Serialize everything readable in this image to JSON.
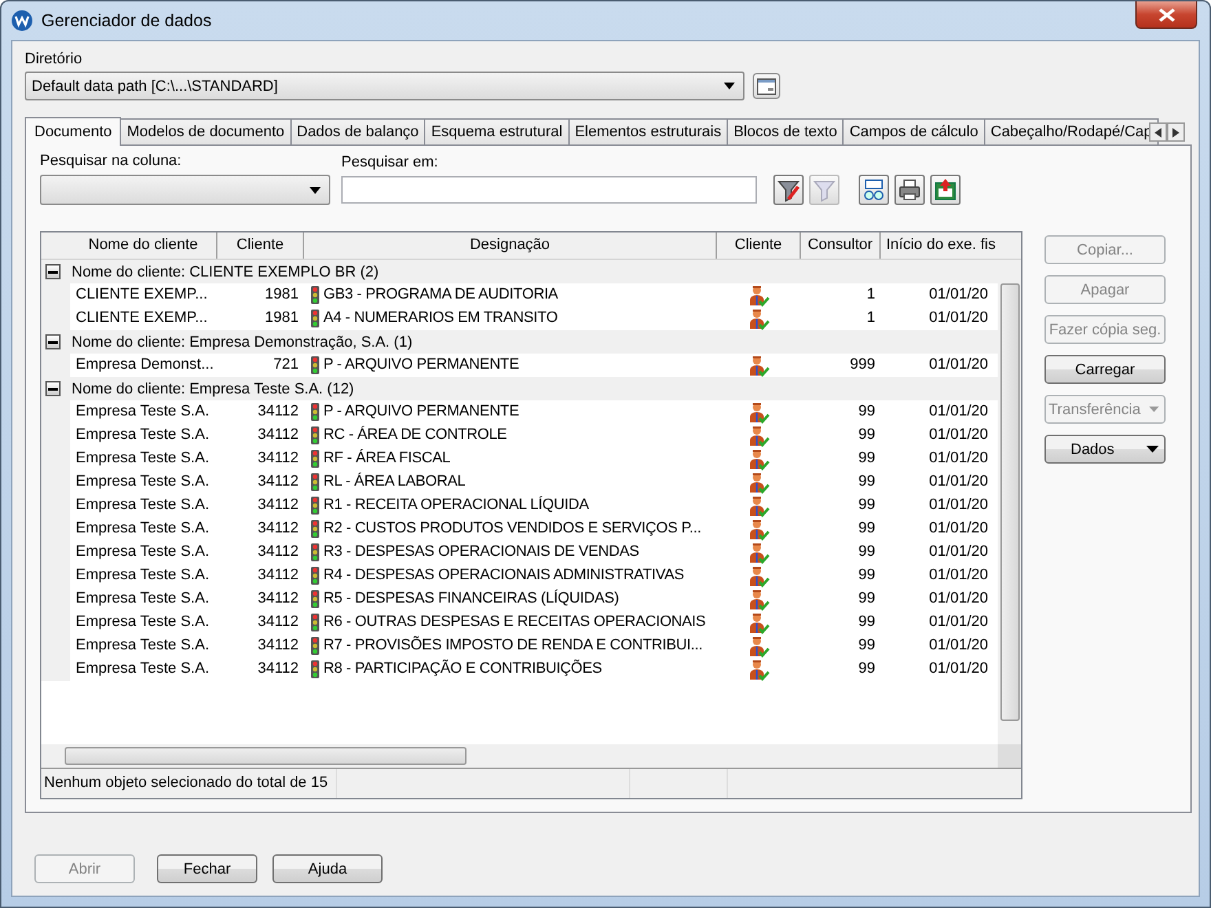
{
  "window": {
    "title": "Gerenciador de dados"
  },
  "directory": {
    "label": "Diretório",
    "value": "Default data path [C:\\...\\STANDARD]"
  },
  "tabs": [
    {
      "label": "Documento",
      "selected": true
    },
    {
      "label": "Modelos de documento",
      "selected": false
    },
    {
      "label": "Dados de balanço",
      "selected": false
    },
    {
      "label": "Esquema estrutural",
      "selected": false
    },
    {
      "label": "Elementos estruturais",
      "selected": false
    },
    {
      "label": "Blocos de texto",
      "selected": false
    },
    {
      "label": "Campos de cálculo",
      "selected": false
    },
    {
      "label": "Cabeçalho/Rodapé/Cap",
      "selected": false
    }
  ],
  "search": {
    "column_label": "Pesquisar na coluna:",
    "in_label": "Pesquisar em:"
  },
  "table": {
    "columns": [
      "Nome do cliente",
      "Cliente",
      "Designação",
      "Cliente",
      "Consultor",
      "Início do exe. fis"
    ],
    "groups": [
      {
        "label": "Nome do cliente: CLIENTE EXEMPLO BR (2)",
        "expanded": true,
        "rows": [
          {
            "name": "CLIENTE EXEMP...",
            "client": "1981",
            "designation": "GB3 - PROGRAMA DE AUDITORIA",
            "consultant": "1",
            "start": "01/01/20"
          },
          {
            "name": "CLIENTE EXEMP...",
            "client": "1981",
            "designation": "A4 - NUMERARIOS EM TRANSITO",
            "consultant": "1",
            "start": "01/01/20"
          }
        ]
      },
      {
        "label": "Nome do cliente: Empresa Demonstração, S.A. (1)",
        "expanded": true,
        "rows": [
          {
            "name": "Empresa Demonst...",
            "client": "721",
            "designation": "P - ARQUIVO PERMANENTE",
            "consultant": "999",
            "start": "01/01/20"
          }
        ]
      },
      {
        "label": "Nome do cliente: Empresa Teste S.A. (12)",
        "expanded": true,
        "rows": [
          {
            "name": "Empresa Teste S.A.",
            "client": "34112",
            "designation": "P - ARQUIVO PERMANENTE",
            "consultant": "99",
            "start": "01/01/20"
          },
          {
            "name": "Empresa Teste S.A.",
            "client": "34112",
            "designation": "RC - ÁREA DE CONTROLE",
            "consultant": "99",
            "start": "01/01/20"
          },
          {
            "name": "Empresa Teste S.A.",
            "client": "34112",
            "designation": "RF - ÁREA FISCAL",
            "consultant": "99",
            "start": "01/01/20"
          },
          {
            "name": "Empresa Teste S.A.",
            "client": "34112",
            "designation": "RL - ÁREA LABORAL",
            "consultant": "99",
            "start": "01/01/20"
          },
          {
            "name": "Empresa Teste S.A.",
            "client": "34112",
            "designation": "R1 - RECEITA OPERACIONAL LÍQUIDA",
            "consultant": "99",
            "start": "01/01/20"
          },
          {
            "name": "Empresa Teste S.A.",
            "client": "34112",
            "designation": "R2 - CUSTOS PRODUTOS VENDIDOS E SERVIÇOS P...",
            "consultant": "99",
            "start": "01/01/20"
          },
          {
            "name": "Empresa Teste S.A.",
            "client": "34112",
            "designation": "R3 - DESPESAS OPERACIONAIS DE VENDAS",
            "consultant": "99",
            "start": "01/01/20"
          },
          {
            "name": "Empresa Teste S.A.",
            "client": "34112",
            "designation": "R4 - DESPESAS OPERACIONAIS ADMINISTRATIVAS",
            "consultant": "99",
            "start": "01/01/20"
          },
          {
            "name": "Empresa Teste S.A.",
            "client": "34112",
            "designation": "R5 - DESPESAS FINANCEIRAS (LÍQUIDAS)",
            "consultant": "99",
            "start": "01/01/20"
          },
          {
            "name": "Empresa Teste S.A.",
            "client": "34112",
            "designation": "R6 - OUTRAS DESPESAS E RECEITAS OPERACIONAIS",
            "consultant": "99",
            "start": "01/01/20"
          },
          {
            "name": "Empresa Teste S.A.",
            "client": "34112",
            "designation": "R7 - PROVISÕES IMPOSTO DE RENDA E CONTRIBUI...",
            "consultant": "99",
            "start": "01/01/20"
          },
          {
            "name": "Empresa Teste S.A.",
            "client": "34112",
            "designation": "R8 - PARTICIPAÇÃO E CONTRIBUIÇÕES",
            "consultant": "99",
            "start": "01/01/20"
          }
        ]
      }
    ]
  },
  "status_bar": "Nenhum objeto selecionado do total de 15",
  "side_buttons": [
    {
      "label": "Copiar...",
      "kind": "plain",
      "disabled": true
    },
    {
      "label": "Apagar",
      "kind": "plain",
      "disabled": true
    },
    {
      "label": "Fazer cópia seg.",
      "kind": "plain",
      "disabled": true
    },
    {
      "label": "Carregar",
      "kind": "plain",
      "disabled": false
    },
    {
      "label": "Transferência",
      "kind": "dropdown",
      "disabled": true
    },
    {
      "label": "Dados",
      "kind": "dropdown",
      "disabled": false
    }
  ],
  "bottom_buttons": [
    {
      "label": "Abrir",
      "disabled": true
    },
    {
      "label": "Fechar",
      "disabled": false
    },
    {
      "label": "Ajuda",
      "disabled": false
    }
  ]
}
